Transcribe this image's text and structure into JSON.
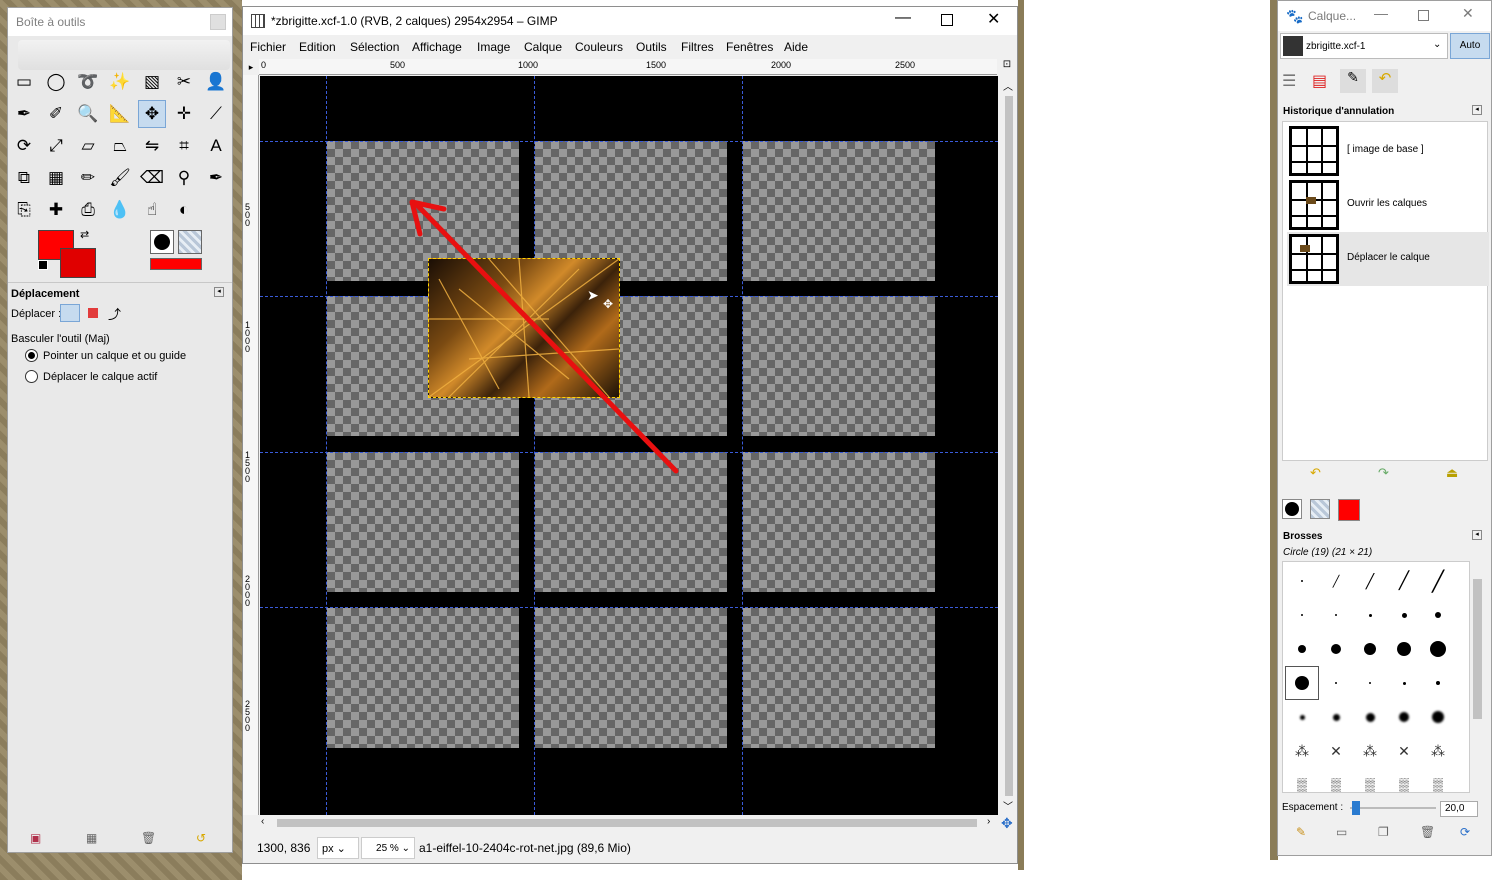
{
  "toolbox": {
    "title": "Boîte à outils",
    "tool_options_title": "Déplacement",
    "move_label": "Déplacer :",
    "toggle_label": "Basculer l'outil  (Maj)",
    "radio_1": "Pointer un calque et ou guide",
    "radio_2": "Déplacer le calque actif",
    "tools": [
      "rect-select",
      "ellipse-select",
      "free-select",
      "fuzzy-select",
      "select-by-color",
      "scissors",
      "foreground-select",
      "paths",
      "color-picker",
      "zoom",
      "measure",
      "move",
      "align",
      "crop",
      "rotate",
      "scale",
      "shear",
      "perspective",
      "flip",
      "cage",
      "text",
      "unified-transform",
      "blend",
      "pencil",
      "paintbrush",
      "eraser",
      "airbrush",
      "ink",
      "clone",
      "heal",
      "perspective-clone",
      "blur",
      "smudge",
      "dodge-burn"
    ]
  },
  "main": {
    "title": "*zbrigitte.xcf-1.0 (RVB, 2 calques) 2954x2954 – GIMP",
    "menu": [
      "Fichier",
      "Edition",
      "Sélection",
      "Affichage",
      "Image",
      "Calque",
      "Couleurs",
      "Outils",
      "Filtres",
      "Fenêtres",
      "Aide"
    ],
    "ruler_h": [
      "0",
      "500",
      "1000",
      "1500",
      "2000",
      "2500"
    ],
    "ruler_v": [
      "500",
      "1000",
      "1500",
      "2000",
      "2500"
    ],
    "status_coords": "1300, 836",
    "status_unit": "px",
    "status_zoom": "25 %",
    "status_file": "a1-eiffel-10-2404c-rot-net.jpg (89,6 Mio)"
  },
  "dock": {
    "title": "Calque...",
    "image_select": "zbrigitte.xcf-1",
    "auto_button": "Auto",
    "history_title": "Historique d'annulation",
    "history": [
      "[ image de base ]",
      "Ouvrir les calques",
      "Déplacer le calque"
    ],
    "brushes_title": "Brosses",
    "brush_name": "Circle (19) (21 × 21)",
    "spacing_label": "Espacement :",
    "spacing_value": "20,0"
  },
  "colors": {
    "foreground": "#ff0000",
    "background": "#e00000",
    "annotation_arrow": "#e81010",
    "guide": "#3a5bd9"
  }
}
